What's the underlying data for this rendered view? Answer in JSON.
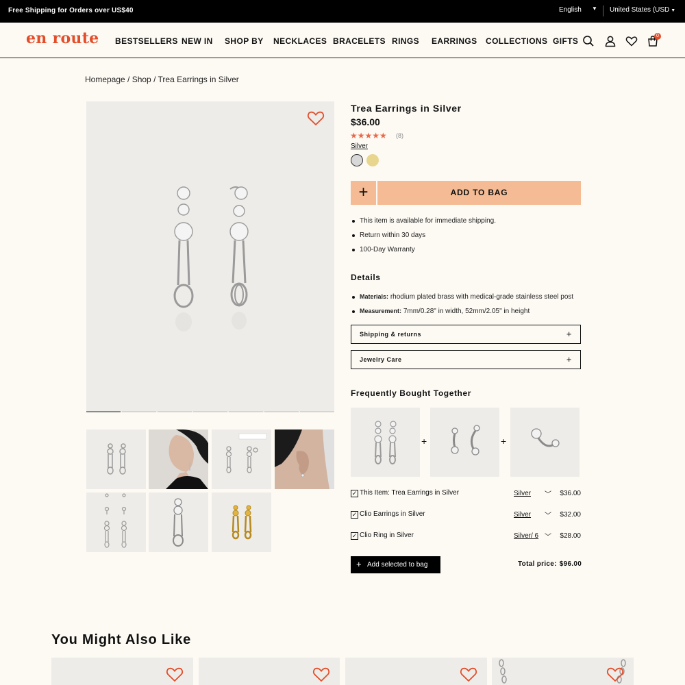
{
  "topbar": {
    "promo": "Free Shipping for Orders over US$40",
    "language": "English",
    "country": "United States (USD"
  },
  "header": {
    "logo": "en route",
    "nav": [
      "BESTSELLERS",
      "NEW IN",
      "SHOP BY",
      "NECKLACES",
      "BRACELETS",
      "RINGS",
      "EARRINGS",
      "COLLECTIONS",
      "GIFTS"
    ],
    "cart_count": "0",
    "icons": [
      "search-icon",
      "account-icon",
      "heart-icon",
      "cart-icon"
    ]
  },
  "breadcrumb": "Homepage / Shop / Trea Earrings in Silver",
  "product": {
    "title": "Trea Earrings in Silver",
    "price": "$36.00",
    "rating": 5,
    "stars": "★★★★★",
    "review_count": "(8)",
    "color_label": "Silver",
    "swatches": [
      {
        "name": "silver",
        "color": "#d8d8d8"
      },
      {
        "name": "gold",
        "color": "#e8d68f"
      }
    ],
    "plus": "+",
    "add_to_bag": "ADD TO BAG",
    "accent_color": "#f4bb94",
    "bullets": [
      "This item is available for immediate shipping.",
      "Return within 30 days",
      "100-Day Warranty"
    ],
    "gallery_count": 7
  },
  "details": {
    "title": "Details",
    "materials_label": "Materials:",
    "materials": "rhodium plated brass with medical-grade stainless steel post",
    "measurement_label": "Measurement:",
    "measurement": "7mm/0.28\" in width, 52mm/2.05\" in height",
    "accordions": [
      {
        "label": "Shipping & returns",
        "icon": "+"
      },
      {
        "label": "Jewelry Care",
        "icon": "+"
      }
    ]
  },
  "fbt": {
    "title": "Frequently Bought Together",
    "plus": "+",
    "items": [
      {
        "name": "This Item: Trea Earrings in Silver",
        "variant": "Silver",
        "price": "$36.00",
        "checked": "✓"
      },
      {
        "name": "Clio Earrings in Silver",
        "variant": "Silver",
        "price": "$32.00",
        "checked": "✓"
      },
      {
        "name": "Clio Ring in Silver",
        "variant": "Silver/ 6",
        "price": "$28.00",
        "checked": "✓"
      }
    ],
    "add_selected": "Add selected to bag",
    "add_plus": "+",
    "total_label": "Total price:",
    "total_value": "$96.00"
  },
  "ymal": {
    "title": "You Might Also Like"
  }
}
